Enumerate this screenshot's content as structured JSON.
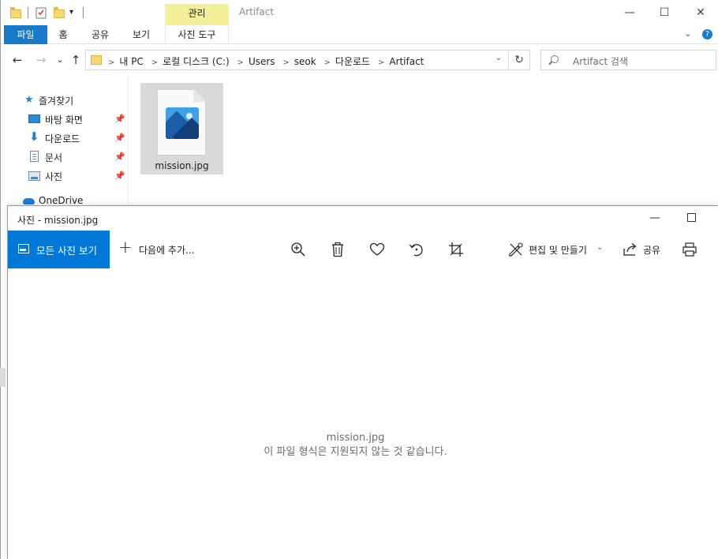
{
  "explorer": {
    "title": "Artifact",
    "tool_tab_header": "관리",
    "ribbon_tabs": [
      "파일",
      "홈",
      "공유",
      "보기"
    ],
    "tool_tab": "사진 도구",
    "ribbon_collapse": "⌄",
    "help_icon": "?",
    "window_controls": {
      "minimize": "—",
      "maximize": "☐",
      "close": "✕"
    },
    "nav": {
      "back": "←",
      "forward": "→",
      "recent": "⌄",
      "up": "↑"
    },
    "breadcrumb": [
      "내 PC",
      "로컬 디스크 (C:)",
      "Users",
      "seok",
      "다운로드",
      "Artifact"
    ],
    "search_placeholder": "Artifact 검색",
    "navpane": [
      {
        "label": "즐겨찾기",
        "icon": "star-icon",
        "pinned": false
      },
      {
        "label": "바탕 화면",
        "icon": "desktop-icon",
        "pinned": true
      },
      {
        "label": "다운로드",
        "icon": "download-icon",
        "pinned": true
      },
      {
        "label": "문서",
        "icon": "document-icon",
        "pinned": true
      },
      {
        "label": "사진",
        "icon": "pictures-icon",
        "pinned": true
      },
      {
        "label": "OneDrive",
        "icon": "onedrive-cloud-icon",
        "pinned": false
      }
    ],
    "files": [
      {
        "name": "mission.jpg",
        "icon": "image-file-icon",
        "selected": true
      }
    ]
  },
  "photos": {
    "title": "사진 - mission.jpg",
    "window_controls": {
      "minimize": "—",
      "maximize": "☐"
    },
    "toolbar": {
      "all_photos": "모든 사진 보기",
      "add_to": "다음에 추가...",
      "edit_create": "편집 및 만들기",
      "share": "공유"
    },
    "file_name": "mission.jpg",
    "error_message": "이 파일 형식은 지원되지 않는 것 같습니다."
  },
  "colors": {
    "accent_blue": "#0078d7",
    "file_tab_blue": "#1979ca",
    "tool_tab_yellow": "#f6ef9a",
    "selection_gray": "#d9d9d9"
  }
}
